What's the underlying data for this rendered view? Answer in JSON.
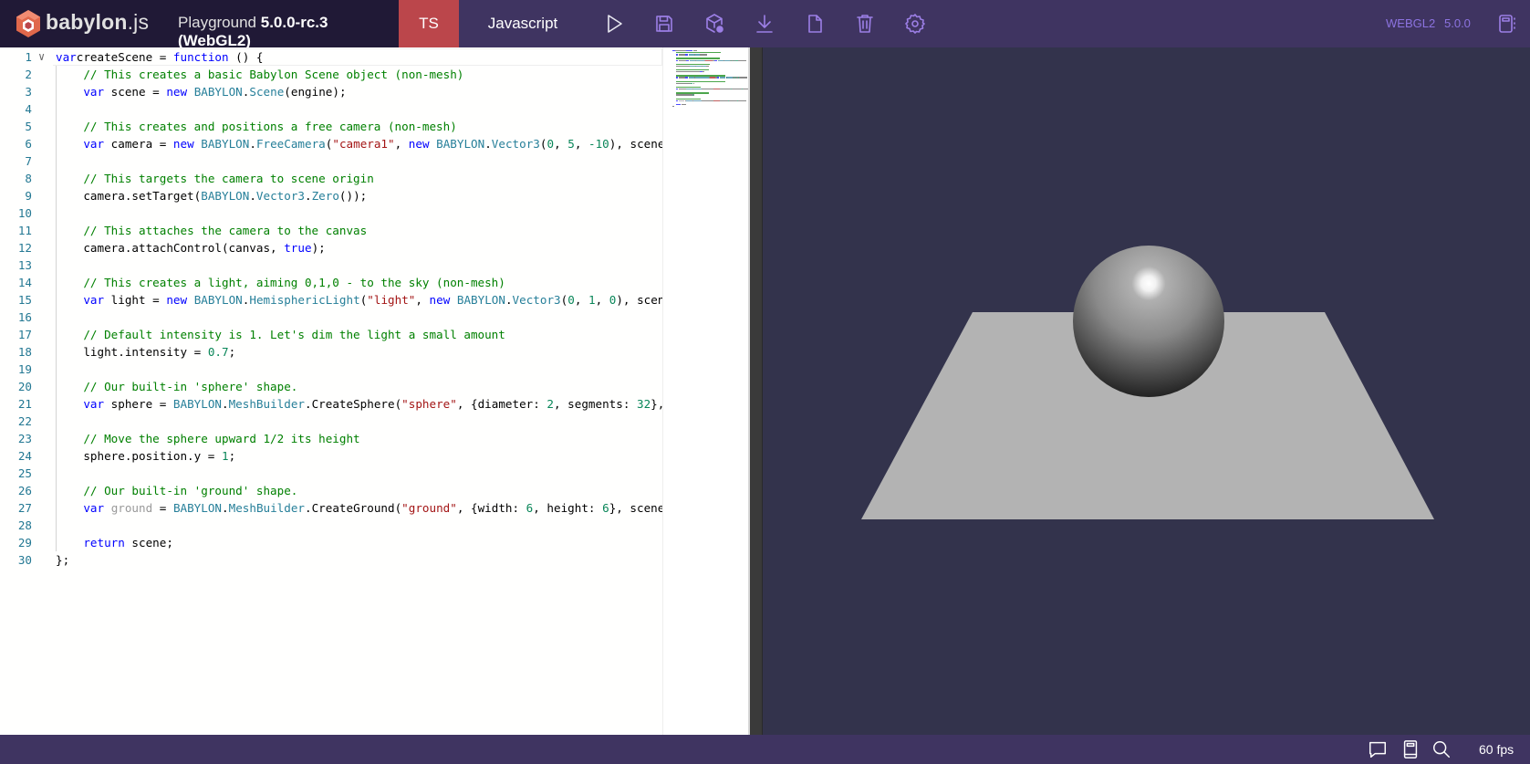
{
  "header": {
    "logo_text": "babylon",
    "logo_suffix": ".js",
    "title_prefix": "Playground ",
    "title_version": "5.0.0-rc.3 (WebGL2)",
    "tabs": [
      {
        "label": "TS",
        "active": true
      },
      {
        "label": "Javascript",
        "active": false
      }
    ],
    "toolbar": [
      {
        "name": "run-icon",
        "label": "Run"
      },
      {
        "name": "save-icon",
        "label": "Save"
      },
      {
        "name": "inspector-cube-icon",
        "label": "Inspector"
      },
      {
        "name": "download-icon",
        "label": "Download"
      },
      {
        "name": "new-file-icon",
        "label": "New"
      },
      {
        "name": "clear-icon",
        "label": "Clear"
      },
      {
        "name": "settings-icon",
        "label": "Settings"
      }
    ],
    "engine": "WEBGL2",
    "version": "5.0.0",
    "accent_color": "#9c7fe6",
    "ts_tab_color": "#bb464b"
  },
  "editor": {
    "language": "javascript",
    "lines": [
      [
        [
          "kw",
          "var"
        ],
        [
          "",
          "createScene = "
        ],
        [
          "kw",
          "function"
        ],
        [
          "",
          " () {"
        ]
      ],
      [
        [
          "",
          "    "
        ],
        [
          "cm",
          "// This creates a basic Babylon Scene object (non-mesh)"
        ]
      ],
      [
        [
          "",
          "    "
        ],
        [
          "kw",
          "var"
        ],
        [
          "",
          " scene = "
        ],
        [
          "kw",
          "new"
        ],
        [
          "",
          " "
        ],
        [
          "ty",
          "BABYLON"
        ],
        [
          "",
          "."
        ],
        [
          "ty",
          "Scene"
        ],
        [
          "",
          "(engine);"
        ]
      ],
      [],
      [
        [
          "",
          "    "
        ],
        [
          "cm",
          "// This creates and positions a free camera (non-mesh)"
        ]
      ],
      [
        [
          "",
          "    "
        ],
        [
          "kw",
          "var"
        ],
        [
          "",
          " camera = "
        ],
        [
          "kw",
          "new"
        ],
        [
          "",
          " "
        ],
        [
          "ty",
          "BABYLON"
        ],
        [
          "",
          "."
        ],
        [
          "ty",
          "FreeCamera"
        ],
        [
          "",
          "("
        ],
        [
          "st",
          "\"camera1\""
        ],
        [
          "",
          ", "
        ],
        [
          "kw",
          "new"
        ],
        [
          "",
          " "
        ],
        [
          "ty",
          "BABYLON"
        ],
        [
          "",
          "."
        ],
        [
          "ty",
          "Vector3"
        ],
        [
          "",
          "("
        ],
        [
          "nm",
          "0"
        ],
        [
          "",
          ", "
        ],
        [
          "nm",
          "5"
        ],
        [
          "",
          ", "
        ],
        [
          "nm",
          "-10"
        ],
        [
          "",
          "), scene);"
        ]
      ],
      [],
      [
        [
          "",
          "    "
        ],
        [
          "cm",
          "// This targets the camera to scene origin"
        ]
      ],
      [
        [
          "",
          "    camera.setTarget("
        ],
        [
          "ty",
          "BABYLON"
        ],
        [
          "",
          "."
        ],
        [
          "ty",
          "Vector3"
        ],
        [
          "",
          "."
        ],
        [
          "ty",
          "Zero"
        ],
        [
          "",
          "());"
        ]
      ],
      [],
      [
        [
          "",
          "    "
        ],
        [
          "cm",
          "// This attaches the camera to the canvas"
        ]
      ],
      [
        [
          "",
          "    camera.attachControl(canvas, "
        ],
        [
          "kw",
          "true"
        ],
        [
          "",
          ");"
        ]
      ],
      [],
      [
        [
          "",
          "    "
        ],
        [
          "cm",
          "// This creates a light, aiming 0,1,0 - to the sky (non-mesh)"
        ]
      ],
      [
        [
          "",
          "    "
        ],
        [
          "kw",
          "var"
        ],
        [
          "",
          " light = "
        ],
        [
          "kw",
          "new"
        ],
        [
          "",
          " "
        ],
        [
          "ty",
          "BABYLON"
        ],
        [
          "",
          "."
        ],
        [
          "ty",
          "HemisphericLight"
        ],
        [
          "",
          "("
        ],
        [
          "st",
          "\"light\""
        ],
        [
          "",
          ", "
        ],
        [
          "kw",
          "new"
        ],
        [
          "",
          " "
        ],
        [
          "ty",
          "BABYLON"
        ],
        [
          "",
          "."
        ],
        [
          "ty",
          "Vector3"
        ],
        [
          "",
          "("
        ],
        [
          "nm",
          "0"
        ],
        [
          "",
          ", "
        ],
        [
          "nm",
          "1"
        ],
        [
          "",
          ", "
        ],
        [
          "nm",
          "0"
        ],
        [
          "",
          "), scene);"
        ]
      ],
      [],
      [
        [
          "",
          "    "
        ],
        [
          "cm",
          "// Default intensity is 1. Let's dim the light a small amount"
        ]
      ],
      [
        [
          "",
          "    light.intensity = "
        ],
        [
          "nm",
          "0.7"
        ],
        [
          "",
          ";"
        ]
      ],
      [],
      [
        [
          "",
          "    "
        ],
        [
          "cm",
          "// Our built-in 'sphere' shape."
        ]
      ],
      [
        [
          "",
          "    "
        ],
        [
          "kw",
          "var"
        ],
        [
          "",
          " sphere = "
        ],
        [
          "ty",
          "BABYLON"
        ],
        [
          "",
          "."
        ],
        [
          "ty",
          "MeshBuilder"
        ],
        [
          "",
          ".CreateSphere("
        ],
        [
          "st",
          "\"sphere\""
        ],
        [
          "",
          ", {diameter: "
        ],
        [
          "nm",
          "2"
        ],
        [
          "",
          ", segments: "
        ],
        [
          "nm",
          "32"
        ],
        [
          "",
          "}, scene);"
        ]
      ],
      [],
      [
        [
          "",
          "    "
        ],
        [
          "cm",
          "// Move the sphere upward 1/2 its height"
        ]
      ],
      [
        [
          "",
          "    sphere.position.y = "
        ],
        [
          "nm",
          "1"
        ],
        [
          "",
          ";"
        ]
      ],
      [],
      [
        [
          "",
          "    "
        ],
        [
          "cm",
          "// Our built-in 'ground' shape."
        ]
      ],
      [
        [
          "",
          "    "
        ],
        [
          "kw",
          "var"
        ],
        [
          "",
          " "
        ],
        [
          "un",
          "ground"
        ],
        [
          "",
          " = "
        ],
        [
          "ty",
          "BABYLON"
        ],
        [
          "",
          "."
        ],
        [
          "ty",
          "MeshBuilder"
        ],
        [
          "",
          ".CreateGround("
        ],
        [
          "st",
          "\"ground\""
        ],
        [
          "",
          ", {width: "
        ],
        [
          "nm",
          "6"
        ],
        [
          "",
          ", height: "
        ],
        [
          "nm",
          "6"
        ],
        [
          "",
          "}, scene);"
        ]
      ],
      [],
      [
        [
          "",
          "    "
        ],
        [
          "kw",
          "return"
        ],
        [
          "",
          " scene;"
        ]
      ],
      [
        [
          "",
          "};"
        ]
      ]
    ]
  },
  "scene": {
    "background_color": "#33334c",
    "objects": [
      "sphere",
      "ground"
    ]
  },
  "footer": {
    "icons": [
      {
        "name": "feedback-icon",
        "label": "Feedback"
      },
      {
        "name": "docs-book-icon",
        "label": "Documentation"
      },
      {
        "name": "search-icon",
        "label": "Search"
      }
    ],
    "fps": "60 fps"
  }
}
